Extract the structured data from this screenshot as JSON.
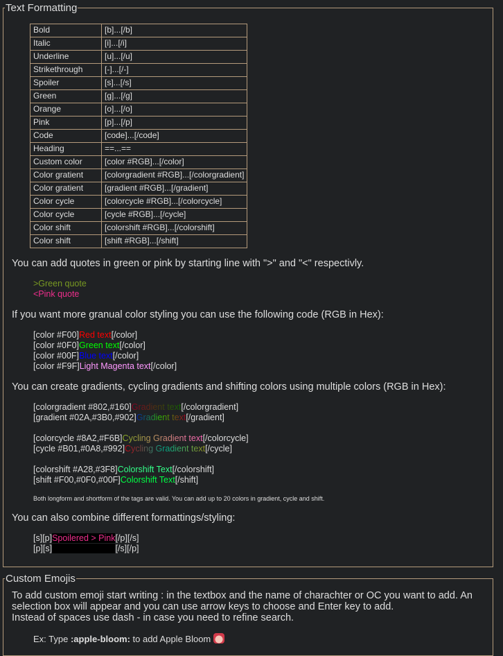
{
  "text_formatting": {
    "legend": "Text Formatting",
    "rows": [
      {
        "name": "Bold",
        "code": "[b]...[/b]"
      },
      {
        "name": "Italic",
        "code": "[i]...[/i]"
      },
      {
        "name": "Underline",
        "code": "[u]...[/u]"
      },
      {
        "name": "Strikethrough",
        "code": "[-]...[/-]"
      },
      {
        "name": "Spoiler",
        "code": "[s]...[/s]"
      },
      {
        "name": "Green",
        "code": "[g]...[/g]"
      },
      {
        "name": "Orange",
        "code": "[o]...[/o]"
      },
      {
        "name": "Pink",
        "code": "[p]...[/p]"
      },
      {
        "name": "Code",
        "code": "[code]...[/code]"
      },
      {
        "name": "Heading",
        "code": "==...=="
      },
      {
        "name": "Custom color",
        "code": "[color #RGB]...[/color]"
      },
      {
        "name": "Color gratient",
        "code": "[colorgradient #RGB]...[/colorgradient]"
      },
      {
        "name": "Color gratient",
        "code": "[gradient #RGB]...[/gradient]"
      },
      {
        "name": "Color cycle",
        "code": "[colorcycle #RGB]...[/colorcycle]"
      },
      {
        "name": "Color cycle",
        "code": "[cycle #RGB]...[/cycle]"
      },
      {
        "name": "Color shift",
        "code": "[colorshift #RGB]...[/colorshift]"
      },
      {
        "name": "Color shift",
        "code": "[shift #RGB]...[/shift]"
      }
    ],
    "quotes_intro": "You can add quotes in green or pink by starting line with \">\" and \"<\" respectivly.",
    "green_quote": ">Green quote",
    "pink_quote": "<Pink quote",
    "color_intro": "If you want more granual color styling you can use the following code (RGB in Hex):",
    "color_examples": [
      {
        "open": "[color #F00]",
        "text": "Red text",
        "close": "[/color]",
        "color": "#ff0000"
      },
      {
        "open": "[color #0F0]",
        "text": "Green text",
        "close": "[/color]",
        "color": "#00ff00"
      },
      {
        "open": "[color #00F]",
        "text": "Blue text",
        "close": "[/color]",
        "color": "#0000ff"
      },
      {
        "open": "[color #F9F]",
        "text": "Light Magenta text",
        "close": "[/color]",
        "color": "#ff99ff"
      }
    ],
    "gradient_intro": "You can create gradients, cycling gradients and shifting colors using multiple colors (RGB in Hex):",
    "gradient_examples": [
      {
        "open": "[colorgradient #802,#160]",
        "text": "Gradient text",
        "close": "[/colorgradient]",
        "colors": [
          "#880022",
          "#116600"
        ]
      },
      {
        "open": "[gradient #02A,#3B0,#902]",
        "text": "Gradient text",
        "close": "[/gradient]",
        "colors": [
          "#0022aa",
          "#33bb00",
          "#990022"
        ]
      }
    ],
    "cycle_examples": [
      {
        "open": "[colorcycle #8A2,#F6B]",
        "text": "Cycling Gradient text",
        "close": "[/colorcycle]",
        "colors": [
          "#88aa22",
          "#ff66bb"
        ]
      },
      {
        "open": "[cycle #B01,#0A8,#992]",
        "text": "Cycling Gradient text",
        "close": "[/cycle]",
        "colors": [
          "#bb0011",
          "#00aa88",
          "#999922"
        ]
      }
    ],
    "shift_examples": [
      {
        "open": "[colorshift #A28,#3F8]",
        "text": "Colorshift Text",
        "close": "[/colorshift]",
        "color": "#33ff88"
      },
      {
        "open": "[shift #F00,#0F0,#00F]",
        "text": "Colorshift Text",
        "close": "[/shift]",
        "color": "#00ff44"
      }
    ],
    "note": "Both longform and shortform of the tags are valid. You can add up to 20 colors in gradient, cycle and shift.",
    "combine_intro": "You can also combine different formattings/styling:",
    "combine_line1": {
      "open": "[s][p]",
      "text": "Spoilered > Pink",
      "close": "[/p][/s]"
    },
    "combine_line2": {
      "open": "[p][s]",
      "text": "Pinked > Spoiler",
      "close": "[/s][/p]"
    }
  },
  "custom_emojis": {
    "legend": "Custom Emojis",
    "text1": "To add custom emoji start writing : in the textbox and the name of charachter or OC you want to add. An selection box will appear and you can use arrow keys to choose and Enter key to add.",
    "text2": "Instead of spaces use dash - in case you need to refine search.",
    "example_prefix": "Ex: Type ",
    "example_code": ":apple-bloom:",
    "example_suffix": " to add Apple Bloom ",
    "emoji_icon": "apple-bloom-emoji"
  },
  "colors": {
    "background": "#202224",
    "border": "#b59b7c",
    "text": "#dedede",
    "green_quote": "#789922",
    "pink_quote": "#ee2e8c",
    "pink": "#ee2e8c"
  }
}
